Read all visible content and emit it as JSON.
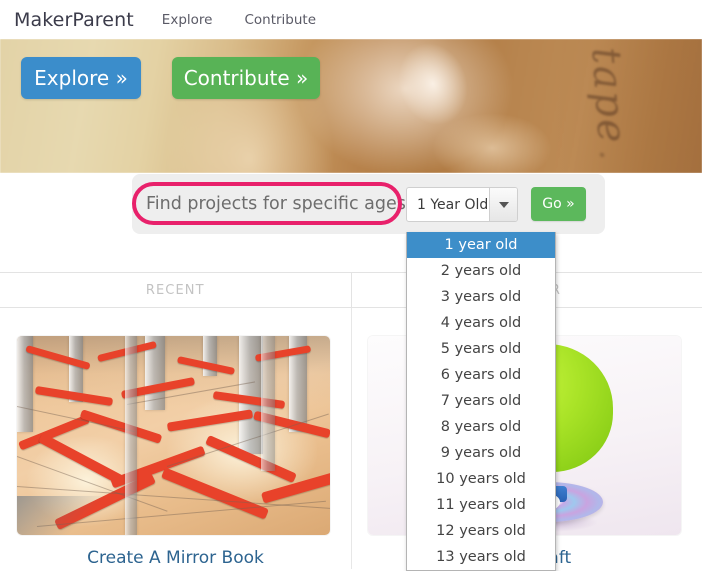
{
  "nav": {
    "brand": "MakerParent",
    "links": [
      {
        "label": "Explore"
      },
      {
        "label": "Contribute"
      }
    ]
  },
  "hero": {
    "buttons": [
      {
        "label": "Explore »",
        "color": "#3b8dcb"
      },
      {
        "label": "Contribute »",
        "color": "#58b356"
      }
    ]
  },
  "filter": {
    "label": "Find projects for specific ages:",
    "selected_value": "1 Year Old",
    "go_label": "Go »",
    "highlight_color": "#e8216b",
    "go_color": "#5cb85c",
    "options": [
      {
        "label": "1 year old",
        "selected": true
      },
      {
        "label": "2 years old",
        "selected": false
      },
      {
        "label": "3 years old",
        "selected": false
      },
      {
        "label": "4 years old",
        "selected": false
      },
      {
        "label": "5 years old",
        "selected": false
      },
      {
        "label": "6 years old",
        "selected": false
      },
      {
        "label": "7 years old",
        "selected": false
      },
      {
        "label": "8 years old",
        "selected": false
      },
      {
        "label": "9 years old",
        "selected": false
      },
      {
        "label": "10 years old",
        "selected": false
      },
      {
        "label": "11 years old",
        "selected": false
      },
      {
        "label": "12 years old",
        "selected": false
      },
      {
        "label": "13 years old",
        "selected": false
      }
    ],
    "option_highlight_color": "#3d8ec9"
  },
  "tabs": [
    {
      "label": "RECENT"
    },
    {
      "label": "POPULAR"
    }
  ],
  "cards": [
    {
      "title": "Create A Mirror Book",
      "image": "mirror-book-photo"
    },
    {
      "title": "Hovercraft",
      "image": "balloon-hovercraft-photo"
    }
  ],
  "link_color": "#2d6490"
}
